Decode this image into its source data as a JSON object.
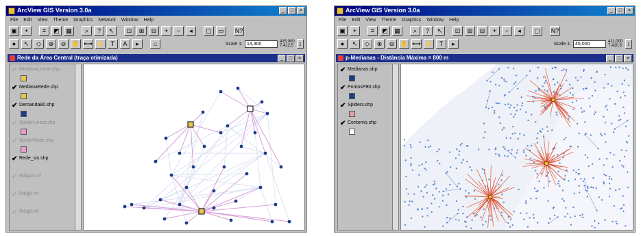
{
  "left_window": {
    "title": "ArcView GIS Version 3.0a",
    "menu": [
      "File",
      "Edit",
      "View",
      "Theme",
      "Graphics",
      "Network",
      "Window",
      "Help"
    ],
    "scale_label": "Scale 1:",
    "scale_value": "14,300",
    "coords": [
      "415,000",
      "7,412,5"
    ],
    "view_title": "Rede da Área Central (traça otimizada)",
    "themes": [
      {
        "name": "MedianaLinear.shp",
        "checked": false,
        "symbol_color": "#e6c84c"
      },
      {
        "name": "MedianaRede.shp",
        "checked": true,
        "symbol_color": "#e6c84c"
      },
      {
        "name": "Demanda80.shp",
        "checked": true,
        "symbol_color": "#1c3c8c"
      },
      {
        "name": "SpiderLinear.shp",
        "checked": false,
        "symbol_color": "#e89ac8"
      },
      {
        "name": "SpiderRede.shp",
        "checked": false,
        "symbol_color": "#e89ac8"
      },
      {
        "name": "Rede_sis.shp",
        "checked": true,
        "symbol_color": ""
      },
      {
        "name": "Rdig10.rvf",
        "checked": false,
        "symbol_color": ""
      },
      {
        "name": "Rdig9.rvf",
        "checked": false,
        "symbol_color": ""
      },
      {
        "name": "Rdig8.rvf",
        "checked": false,
        "symbol_color": ""
      }
    ]
  },
  "right_window": {
    "title": "ArcView GIS Version 3.0a",
    "menu": [
      "File",
      "Edit",
      "View",
      "Theme",
      "Graphics",
      "Window",
      "Help"
    ],
    "scale_label": "Scale 1:",
    "scale_value": "45,000",
    "coords": [
      "411,000",
      "7,410,5"
    ],
    "view_title": "p-Medianas - Distância Máxima = 800 m",
    "themes": [
      {
        "name": "Medianas.shp",
        "checked": true,
        "symbol_color": "#1c3c8c"
      },
      {
        "name": "PontosP80.shp",
        "checked": true,
        "symbol_color": "#1c3c8c"
      },
      {
        "name": "Spiders.shp",
        "checked": true,
        "symbol_color": "#e8a0a0"
      },
      {
        "name": "Contorno.shp",
        "checked": true,
        "symbol_color": "#ffffff"
      }
    ]
  },
  "colors": {
    "titlebar": "#000080",
    "view_titlebar": "#1c2f8c",
    "median": "#e6c84c",
    "demand_point": "#1c3c8c",
    "spider_left": "#d8a0d8",
    "spider_right": "#e05030",
    "network_right": "#4a78c8"
  }
}
